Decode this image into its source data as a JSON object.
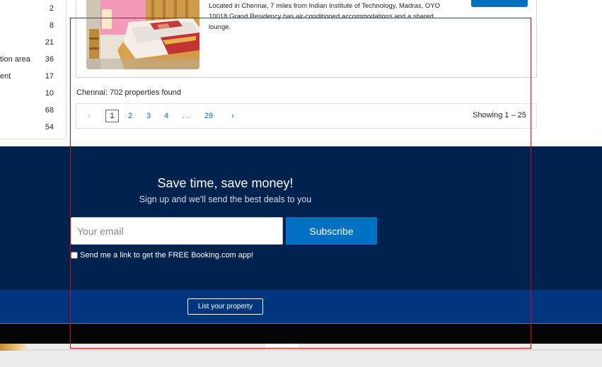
{
  "sidebar": {
    "filters": [
      {
        "label": "",
        "count": "2"
      },
      {
        "label": "",
        "count": "8"
      },
      {
        "label": "",
        "count": "21"
      },
      {
        "label": "tion area",
        "count": "36"
      },
      {
        "label": "ent",
        "count": "17"
      },
      {
        "label": "",
        "count": "10"
      },
      {
        "label": "",
        "count": "68"
      },
      {
        "label": "",
        "count": "54"
      }
    ]
  },
  "listing": {
    "description": "Located in Chennai, 7 miles from Indian Institute of Technology, Madras, OYO 10018 Grand Residency has air-conditioned accommodations and a shared lounge."
  },
  "results": {
    "summary": "Chennai: 702 properties found"
  },
  "pagination": {
    "prev_icon": "chevron-left-icon",
    "next_icon": "chevron-right-icon",
    "prev_glyph": "‹",
    "next_glyph": "›",
    "pages": [
      "1",
      "2",
      "3",
      "4",
      "…",
      "29"
    ],
    "current": "1",
    "showing": "Showing 1 – 25"
  },
  "newsletter": {
    "title": "Save time, save money!",
    "subtitle": "Sign up and we'll send the best deals to you",
    "email_placeholder": "Your email",
    "subscribe_label": "Subscribe",
    "app_link_label": "Send me a link to get the FREE Booking.com app!"
  },
  "footer": {
    "list_property_label": "List your property"
  },
  "colors": {
    "brand_blue": "#0071c2",
    "navy": "#00224f",
    "footer_blue": "#003580",
    "annotation_red": "#e00000"
  }
}
